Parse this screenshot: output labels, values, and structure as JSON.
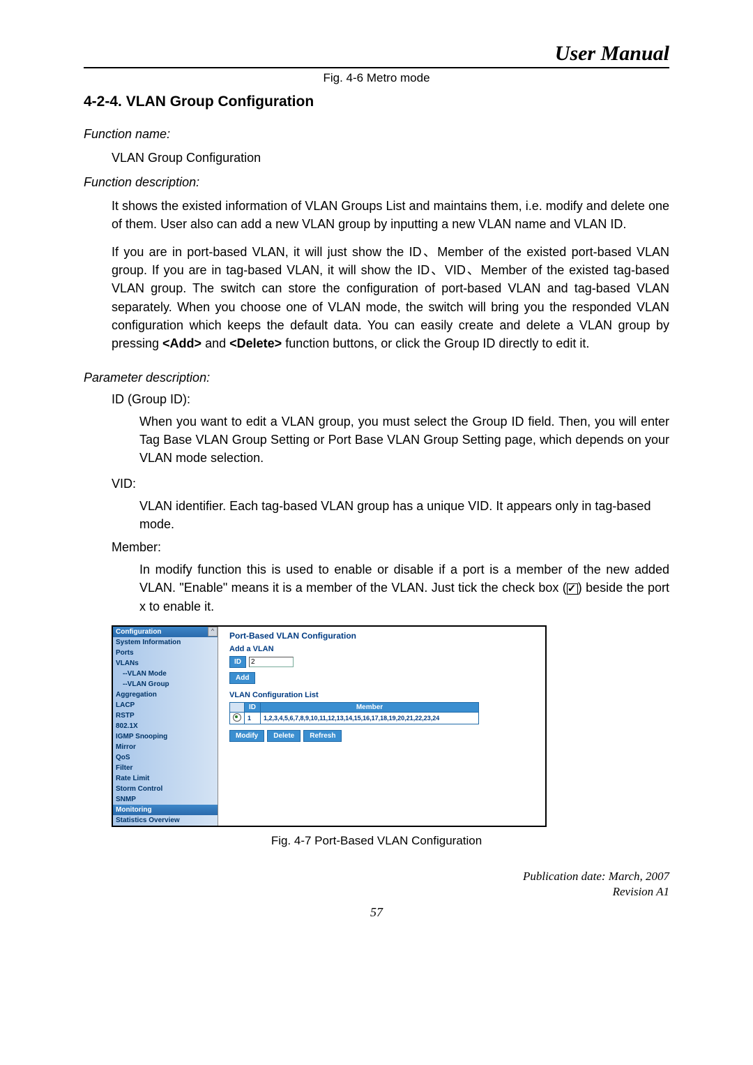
{
  "header": {
    "title": "User Manual"
  },
  "captions": {
    "top": "Fig. 4-6 Metro mode",
    "bottom": "Fig. 4-7 Port-Based VLAN Configuration"
  },
  "section": {
    "heading": "4-2-4. VLAN Group Configuration"
  },
  "labels": {
    "function_name": "Function name:",
    "function_description": "Function description:",
    "parameter_description": "Parameter description:"
  },
  "function_name_value": "VLAN Group Configuration",
  "description_p1": "It shows the existed information of VLAN Groups List and maintains them, i.e. modify and delete one of them. User also can add a new VLAN group by inputting a new VLAN name and VLAN ID.",
  "description_p2_a": "If you are in port-based VLAN, it will just show the ID、Member of the existed port-based VLAN group. If you are in tag-based VLAN, it will show the ID、VID、Member of the existed tag-based VLAN group. The switch can store the configuration of port-based VLAN and tag-based VLAN separately. When you choose one of VLAN mode, the switch will bring you the responded VLAN configuration which keeps the default data. You can easily create and delete a VLAN group by pressing ",
  "description_p2_add": "<Add>",
  "description_p2_b": " and ",
  "description_p2_del": "<Delete>",
  "description_p2_c": " function buttons, or click the Group ID directly to edit it.",
  "param_id_label": "ID (Group ID):",
  "param_id_text": "When you want to edit a VLAN group, you must select the Group ID field. Then, you will enter Tag Base VLAN Group Setting or Port Base VLAN Group Setting page, which depends on your VLAN mode selection.",
  "param_vid_label": "VID:",
  "param_vid_text": "VLAN identifier. Each tag-based VLAN group has a unique VID. It appears only in tag-based mode.",
  "param_member_label": "Member:",
  "param_member_text_a": "In modify function this is used to enable or disable if a port is a member of the new added VLAN. \"Enable\" means it is a member of the VLAN. Just tick the check box (",
  "param_member_text_b": ") beside the port x to enable it.",
  "screenshot": {
    "nav_header1": "Configuration",
    "items": [
      "System Information",
      "Ports",
      "VLANs",
      "--VLAN Mode",
      "--VLAN Group",
      "Aggregation",
      "LACP",
      "RSTP",
      "802.1X",
      "IGMP Snooping",
      "Mirror",
      "QoS",
      "Filter",
      "Rate Limit",
      "Storm Control",
      "SNMP"
    ],
    "nav_header2": "Monitoring",
    "items2": [
      "Statistics Overview"
    ],
    "title": "Port-Based VLAN Configuration",
    "add_label": "Add a VLAN",
    "id_label": "ID",
    "id_value": "2",
    "add_btn": "Add",
    "list_label": "VLAN Configuration List",
    "th_id": "ID",
    "th_member": "Member",
    "row_id": "1",
    "row_member": "1,2,3,4,5,6,7,8,9,10,11,12,13,14,15,16,17,18,19,20,21,22,23,24",
    "btn_modify": "Modify",
    "btn_delete": "Delete",
    "btn_refresh": "Refresh"
  },
  "footer": {
    "pub": "Publication date: March, 2007",
    "rev": "Revision A1",
    "page": "57"
  }
}
